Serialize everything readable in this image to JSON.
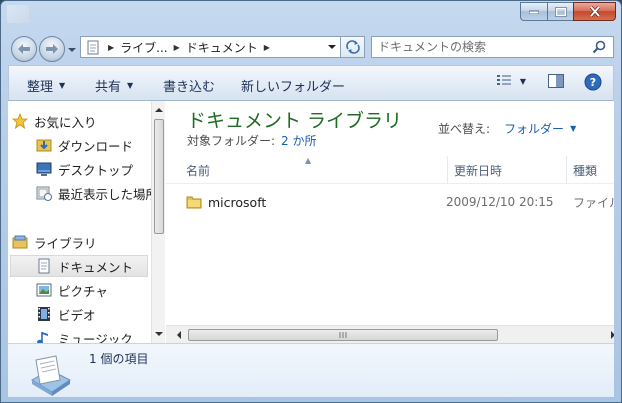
{
  "titlebar": {
    "buttons": [
      "minimize",
      "maximize",
      "close"
    ]
  },
  "address": {
    "crumbs": [
      "ライブ...",
      "ドキュメント"
    ]
  },
  "search": {
    "placeholder": "ドキュメントの検索"
  },
  "commandbar": {
    "organize": "整理",
    "share": "共有",
    "burn": "書き込む",
    "new_folder": "新しいフォルダー"
  },
  "navpane": {
    "favorites": "お気に入り",
    "downloads": "ダウンロード",
    "desktop": "デスクトップ",
    "recent": "最近表示した場所",
    "libraries": "ライブラリ",
    "documents": "ドキュメント",
    "pictures": "ピクチャ",
    "videos": "ビデオ",
    "music": "ミュージック"
  },
  "library": {
    "title": "ドキュメント ライブラリ",
    "target_label": "対象フォルダー:",
    "target_link": "2 か所",
    "arrange_label": "並べ替え:",
    "arrange_value": "フォルダー"
  },
  "columns": {
    "name": "名前",
    "date": "更新日時",
    "type": "種類"
  },
  "files": [
    {
      "name": "microsoft",
      "date": "2009/12/10 20:15",
      "type": "ファイル"
    }
  ],
  "details": {
    "count": "1 個の項目"
  },
  "colors": {
    "title_green": "#1e6b22",
    "link_blue": "#1a5fb4",
    "command_text": "#1e3157"
  }
}
